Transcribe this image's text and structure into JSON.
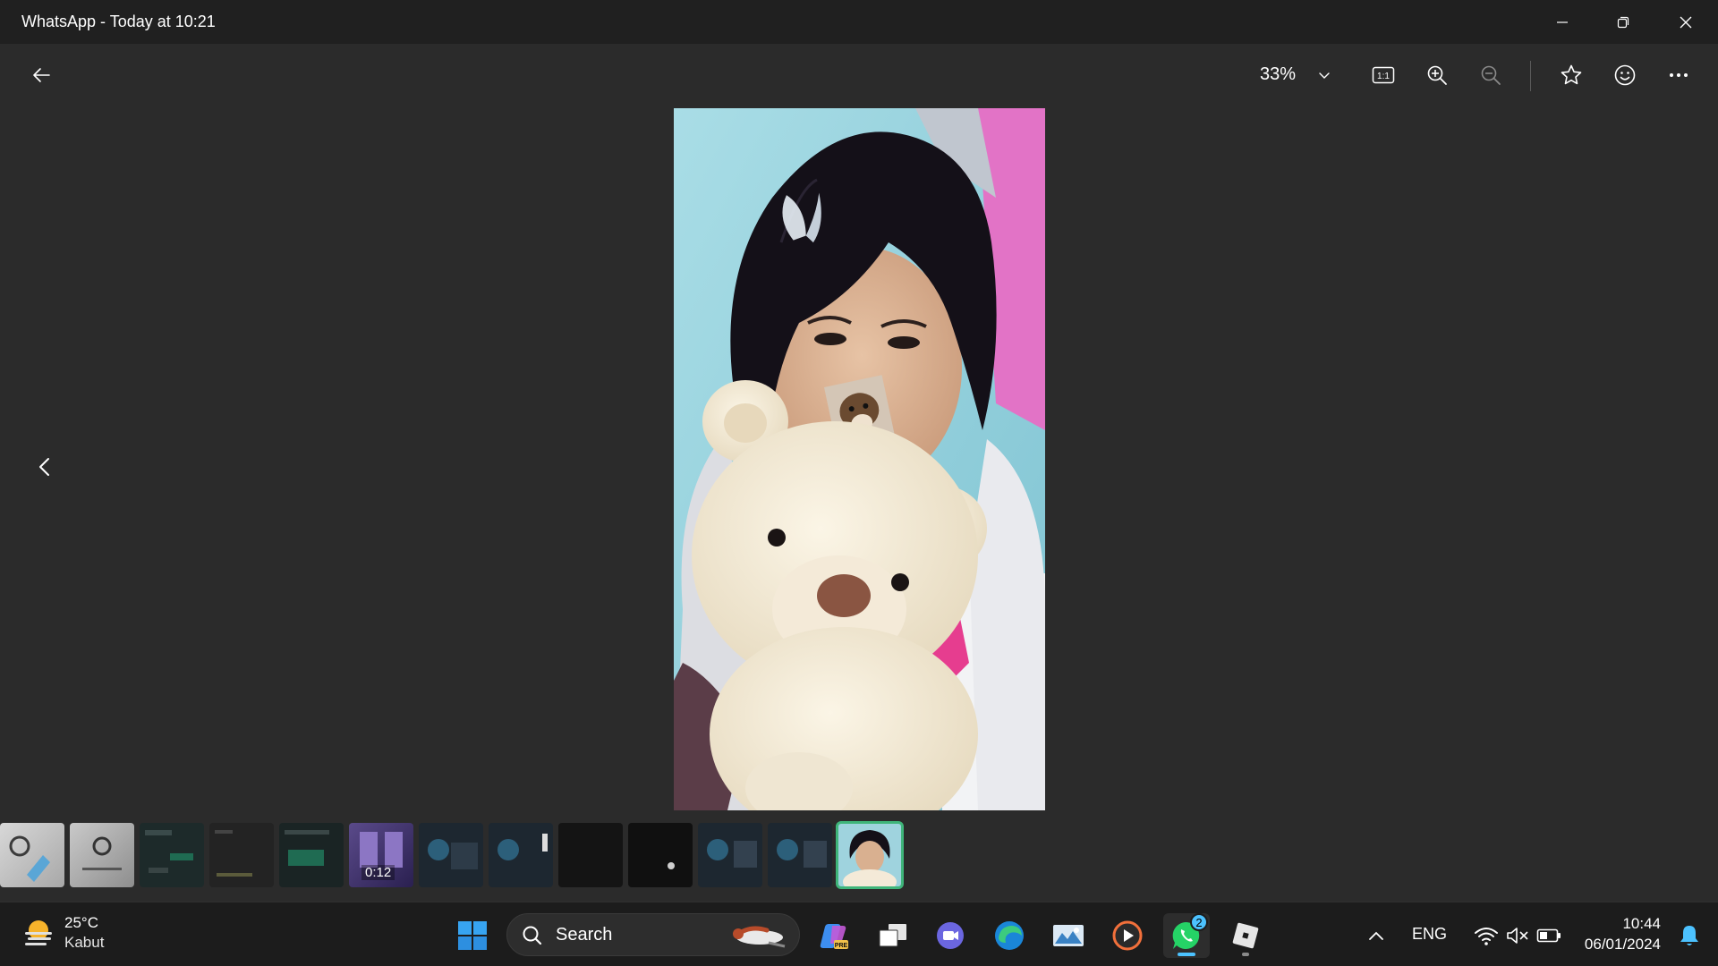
{
  "window": {
    "title": "WhatsApp - Today at 10:21"
  },
  "toolbar": {
    "zoom_level": "33%",
    "back_icon": "arrow-left-icon",
    "actual_size_icon": "actual-size-icon",
    "zoom_in_icon": "zoom-in-icon",
    "zoom_out_icon": "zoom-out-icon",
    "favorite_icon": "star-icon",
    "emoji_icon": "smiley-icon",
    "more_icon": "more-icon"
  },
  "filmstrip": {
    "thumbnails": [
      {
        "kind": "screenshot-light"
      },
      {
        "kind": "screenshot-light"
      },
      {
        "kind": "screenshot-dark"
      },
      {
        "kind": "screenshot-dark"
      },
      {
        "kind": "screenshot-dark"
      },
      {
        "kind": "video",
        "duration": "0:12"
      },
      {
        "kind": "screenshot-blue"
      },
      {
        "kind": "screenshot-blue"
      },
      {
        "kind": "dark"
      },
      {
        "kind": "dark"
      },
      {
        "kind": "screenshot-blue"
      },
      {
        "kind": "screenshot-blue"
      },
      {
        "kind": "photo",
        "selected": true
      }
    ]
  },
  "taskbar": {
    "weather": {
      "temperature": "25°C",
      "condition": "Kabut"
    },
    "search_label": "Search",
    "apps": [
      "windows-start",
      "copilot",
      "task-view",
      "teams",
      "edge",
      "photos",
      "media-player",
      "whatsapp",
      "roblox"
    ],
    "whatsapp_badge": "2",
    "language": "ENG",
    "time": "10:44",
    "date": "06/01/2024"
  },
  "colors": {
    "background": "#2b2b2b",
    "titlebar": "#202020",
    "taskbar": "#1c1c1c",
    "accent": "#4cc2ff",
    "selection": "#3fb57a"
  }
}
